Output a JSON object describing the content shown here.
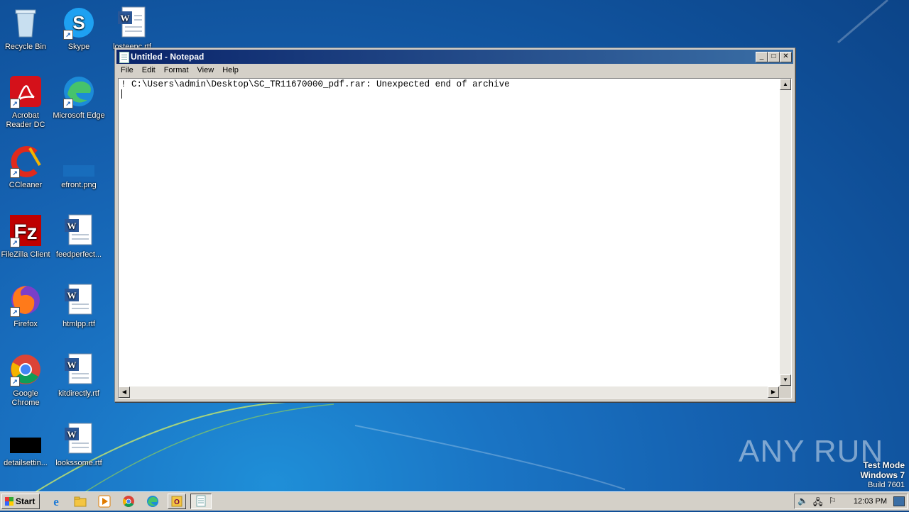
{
  "desktop": {
    "icons": [
      {
        "label": "Recycle Bin"
      },
      {
        "label": "Skype"
      },
      {
        "label": "losteenc.rtf"
      },
      {
        "label": "Acrobat Reader DC"
      },
      {
        "label": "Microsoft Edge"
      },
      {
        "label": "CCleaner"
      },
      {
        "label": "efront.png"
      },
      {
        "label": "FileZilla Client"
      },
      {
        "label": "feedperfect..."
      },
      {
        "label": "Firefox"
      },
      {
        "label": "htmlpp.rtf"
      },
      {
        "label": "Google Chrome"
      },
      {
        "label": "kitdirectly.rtf"
      },
      {
        "label": "detailsettin..."
      },
      {
        "label": "lookssome.rtf"
      }
    ]
  },
  "notepad": {
    "title": "Untitled - Notepad",
    "menu": [
      "File",
      "Edit",
      "Format",
      "View",
      "Help"
    ],
    "content": "! C:\\Users\\admin\\Desktop\\SC_TR11670000_pdf.rar: Unexpected end of archive",
    "buttons": {
      "minimize": "_",
      "maximize": "□",
      "close": "✕"
    }
  },
  "taskbar": {
    "start_label": "Start",
    "clock": "12:03 PM"
  },
  "watermark": {
    "line1": "Test Mode",
    "line2": "Windows 7",
    "line3": "Build 7601",
    "brand": "ANY RUN"
  },
  "colors": {
    "titlebar_start": "#0a246a",
    "titlebar_end": "#3a6ea5",
    "desktop": "#1561b0"
  }
}
